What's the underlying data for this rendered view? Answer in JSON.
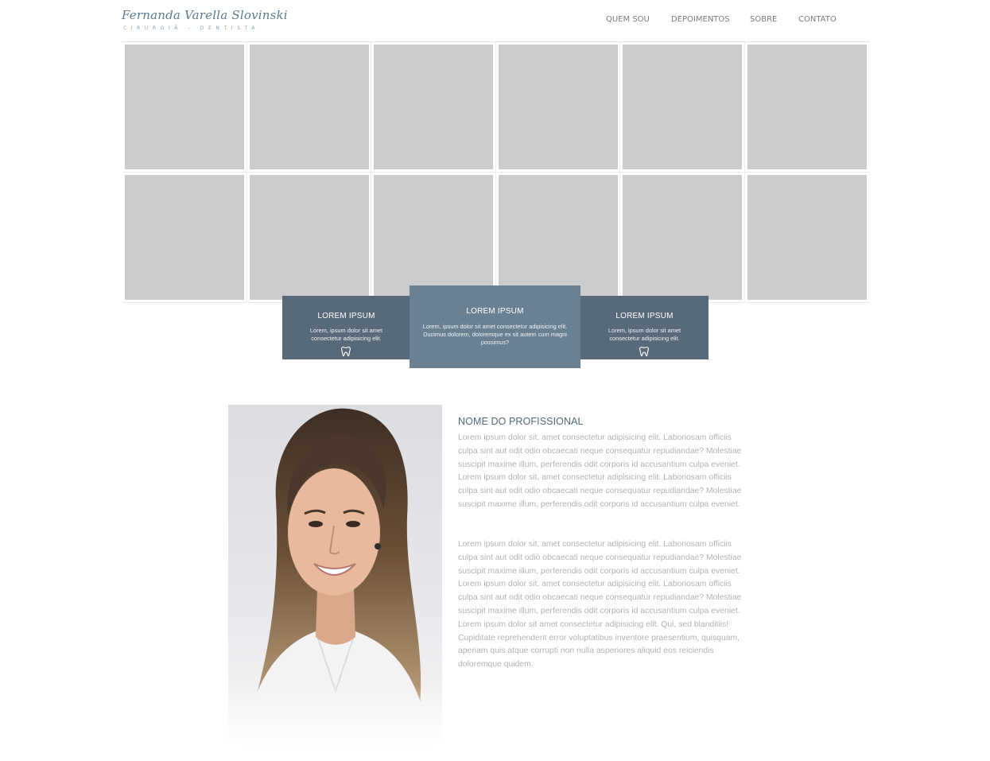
{
  "header": {
    "logo_name": "Fernanda Varella Slovinski",
    "logo_subtitle": "CIRURGIÃ - DENTISTA",
    "nav": [
      "QUEM SOU",
      "DEPOIMENTOS",
      "SOBRE",
      "CONTATO"
    ]
  },
  "gallery": {
    "rows": 2,
    "columns": 6
  },
  "cards": [
    {
      "title": "LOREM IPSUM",
      "text": "Lorem, ipsum dolor sit amet consectetur adipisicing elit.",
      "icon": "tooth-icon"
    },
    {
      "title": "LOREM IPSUM",
      "text": "Lorem, ipsum dolor sit amet consectetur adipisicing elit. Ducimus dolorem, doloremque ex sit autem cum magni possimus?"
    },
    {
      "title": "LOREM IPSUM",
      "text": "Lorem, ipsum dolor sit amet consectetur adipisicing elit.",
      "icon": "tooth-icon"
    }
  ],
  "profile": {
    "name": "NOME DO PROFISSIONAL",
    "bio": [
      "Lorem ipsum dolor sit, amet consectetur adipisicing elit. Laboriosam officiis culpa sint aut odit odio obcaecati neque consequatur repudiandae? Molestiae suscipit maxime illum, perferendis odit corporis id accusantium culpa eveniet. Lorem ipsum dolor sit, amet consectetur adipisicing elit. Laboriosam officiis culpa sint aut odit odio obcaecati neque consequatur repudiandae? Molestiae suscipit maxime illum, perferendis odit corporis id accusantium culpa eveniet.",
      "Lorem ipsum dolor sit, amet consectetur adipisicing elit. Laboriosam officiis culpa sint aut odit odio obcaecati neque consequatur repudiandae? Molestiae suscipit maxime illum, perferendis odit corporis id accusantium culpa eveniet. Lorem ipsum dolor sit, amet consectetur adipisicing elit. Laboriosam officiis culpa sint aut odit odio obcaecati neque consequatur repudiandae? Molestiae suscipit maxime illum, perferendis odit corporis id accusantium culpa eveniet. Lorem ipsum dolor sit amet consectetur adipisicing elit. Qui, sed blanditiis! Cupiditate reprehenderit error voluptatibus inventore praesentium, quisquam, aperiam quis atque corrupti non nulla asperiores aliquid eos reiciendis doloremque quidem."
    ]
  },
  "colors": {
    "card_dark": "#586a79",
    "card_highlight": "#6a8193",
    "placeholder": "#cccccc",
    "heading": "#53687a",
    "body_text": "#b3b3b3"
  }
}
